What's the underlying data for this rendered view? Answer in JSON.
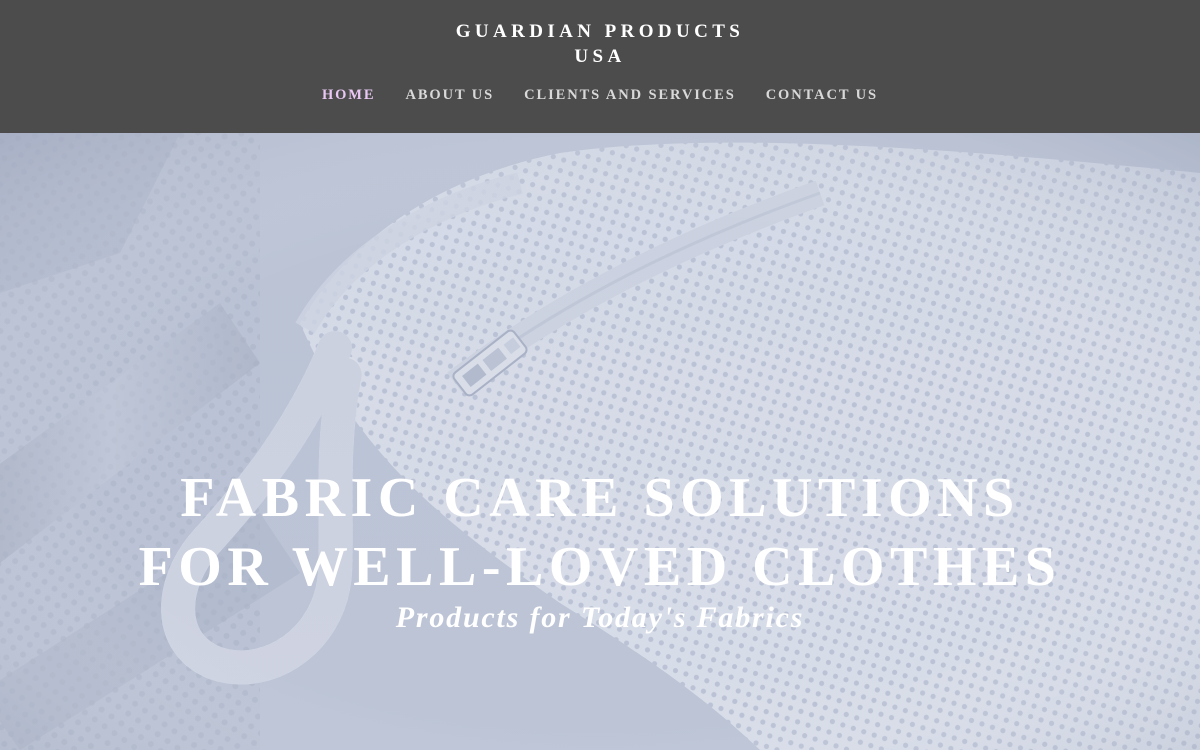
{
  "header": {
    "brand_line1": "GUARDIAN PRODUCTS",
    "brand_line2": "USA",
    "nav": {
      "home": "HOME",
      "about": "ABOUT US",
      "clients": "CLIENTS AND SERVICES",
      "contact": "CONTACT US"
    },
    "active_item": "HOME"
  },
  "hero": {
    "title_line1": "FABRIC CARE SOLUTIONS",
    "title_line2": "FOR WELL-LOVED CLOTHES",
    "subtitle": "Products for Today's Fabrics",
    "image_subject": "white mesh laundry bag with zipper pull and drawstring cord"
  },
  "colors": {
    "header_bg": "#4c4c4c",
    "nav_text": "#d9d9d9",
    "nav_active": "#e9c8f3",
    "hero_tint": "#c8cfdc",
    "hero_text": "#ffffff"
  }
}
